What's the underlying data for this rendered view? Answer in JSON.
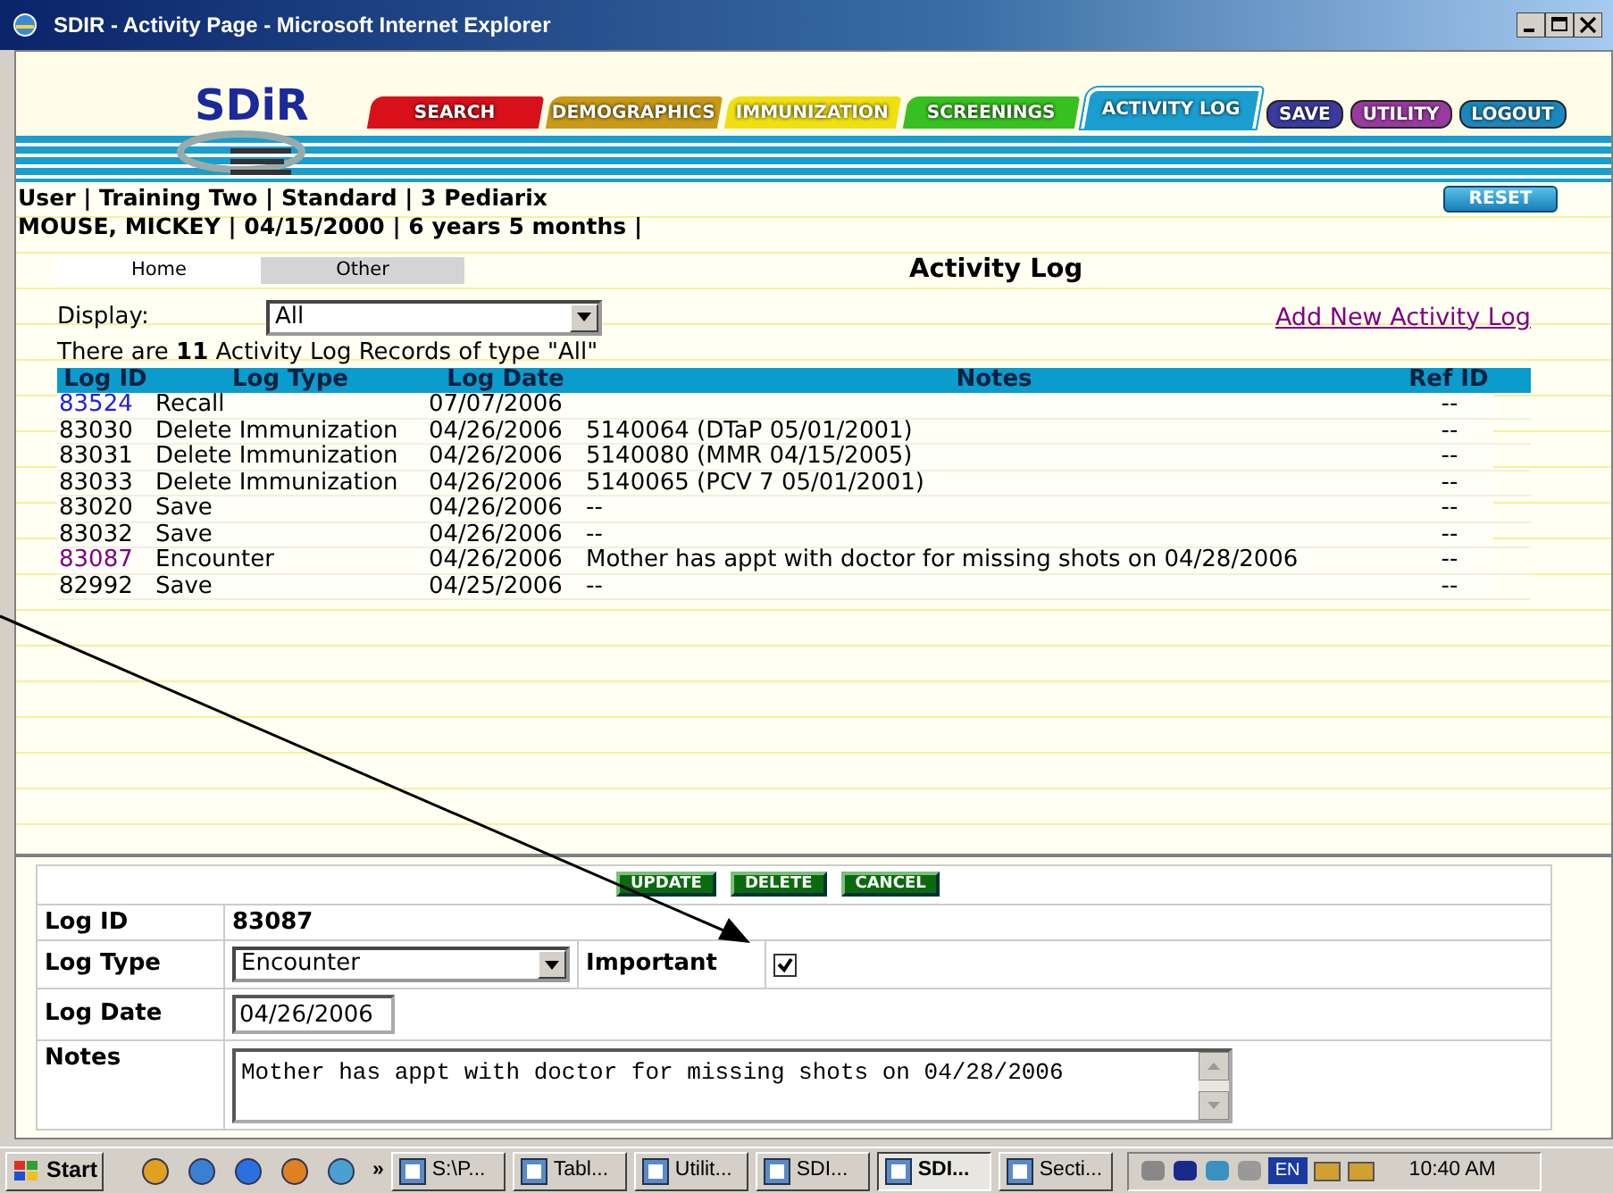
{
  "window": {
    "title": "SDIR - Activity Page - Microsoft Internet Explorer"
  },
  "logo": {
    "text": "SDiR"
  },
  "nav_tabs": [
    {
      "label": "SEARCH",
      "color": "#d8101a",
      "selected": false,
      "kind": "tab"
    },
    {
      "label": "DEMOGRAPHICS",
      "color": "#c89a18",
      "selected": false,
      "kind": "tab"
    },
    {
      "label": "IMMUNIZATION",
      "color": "#f0e010",
      "selected": false,
      "kind": "tab"
    },
    {
      "label": "SCREENINGS",
      "color": "#38c020",
      "selected": false,
      "kind": "tab"
    },
    {
      "label": "ACTIVITY LOG",
      "color": "#1a9ed0",
      "selected": true,
      "kind": "tab"
    },
    {
      "label": "SAVE",
      "color": "#3a3aa0",
      "selected": false,
      "kind": "button"
    },
    {
      "label": "UTILITY",
      "color": "#9a3aa0",
      "selected": false,
      "kind": "button"
    },
    {
      "label": "LOGOUT",
      "color": "#1a88c0",
      "selected": false,
      "kind": "button"
    }
  ],
  "user_info": [
    "User | Training Two | Standard | 3 Pediarix",
    "MOUSE, MICKEY | 04/15/2000 | 6 years 5 months |"
  ],
  "reset_button": "RESET",
  "sub_tabs": [
    {
      "label": "Home",
      "selected": true
    },
    {
      "label": "Other",
      "selected": false
    }
  ],
  "page_title": "Activity Log",
  "display": {
    "label": "Display:",
    "value": "All"
  },
  "add_link": "Add New Activity Log",
  "record_count": "There are **11** Activity Log Records of type \"All\"",
  "table": {
    "columns": [
      "Log ID",
      "Log Type",
      "Log Date",
      "Notes",
      "Ref ID"
    ],
    "rows": [
      {
        "log_id": "83524",
        "kind": "link",
        "log_type": "Recall",
        "log_date": "07/07/2006",
        "notes": "",
        "ref_id": "--"
      },
      {
        "log_id": "83030",
        "kind": "plain",
        "log_type": "Delete Immunization",
        "log_date": "04/26/2006",
        "notes": "5140064 (DTaP 05/01/2001)",
        "ref_id": "--"
      },
      {
        "log_id": "83031",
        "kind": "plain",
        "log_type": "Delete Immunization",
        "log_date": "04/26/2006",
        "notes": "5140080 (MMR 04/15/2005)",
        "ref_id": "--"
      },
      {
        "log_id": "83033",
        "kind": "plain",
        "log_type": "Delete Immunization",
        "log_date": "04/26/2006",
        "notes": "5140065 (PCV 7 05/01/2001)",
        "ref_id": "--"
      },
      {
        "log_id": "83020",
        "kind": "plain",
        "log_type": "Save",
        "log_date": "04/26/2006",
        "notes": "--",
        "ref_id": "--"
      },
      {
        "log_id": "83032",
        "kind": "plain",
        "log_type": "Save",
        "log_date": "04/26/2006",
        "notes": "--",
        "ref_id": "--"
      },
      {
        "log_id": "83087",
        "kind": "visited_link",
        "log_type": "Encounter",
        "log_date": "04/26/2006",
        "notes": "Mother has appt with doctor for missing shots on 04/28/2006",
        "ref_id": "--"
      },
      {
        "log_id": "82992",
        "kind": "plain",
        "log_type": "Save",
        "log_date": "04/25/2006",
        "notes": "--",
        "ref_id": "--"
      }
    ]
  },
  "form": {
    "buttons": [
      "UPDATE",
      "DELETE",
      "CANCEL"
    ],
    "log_id": {
      "label": "Log ID",
      "value": "83087"
    },
    "log_type": {
      "label": "Log Type",
      "value": "Encounter"
    },
    "important": {
      "label": "Important",
      "checked": true
    },
    "log_date": {
      "label": "Log Date",
      "value": "04/26/2006"
    },
    "notes": {
      "label": "Notes",
      "value": "Mother has appt with doctor for missing shots on 04/28/2006"
    }
  },
  "taskbar": {
    "start": "Start",
    "more": "»",
    "tasks": [
      {
        "label": "S:\\P...",
        "selected": false
      },
      {
        "label": "Tabl...",
        "selected": false
      },
      {
        "label": "Utilit...",
        "selected": false
      },
      {
        "label": "SDI...",
        "selected": false
      },
      {
        "label": "SDI...",
        "selected": true
      },
      {
        "label": "Secti...",
        "selected": false
      }
    ],
    "language": "EN",
    "clock": "10:40 AM"
  }
}
